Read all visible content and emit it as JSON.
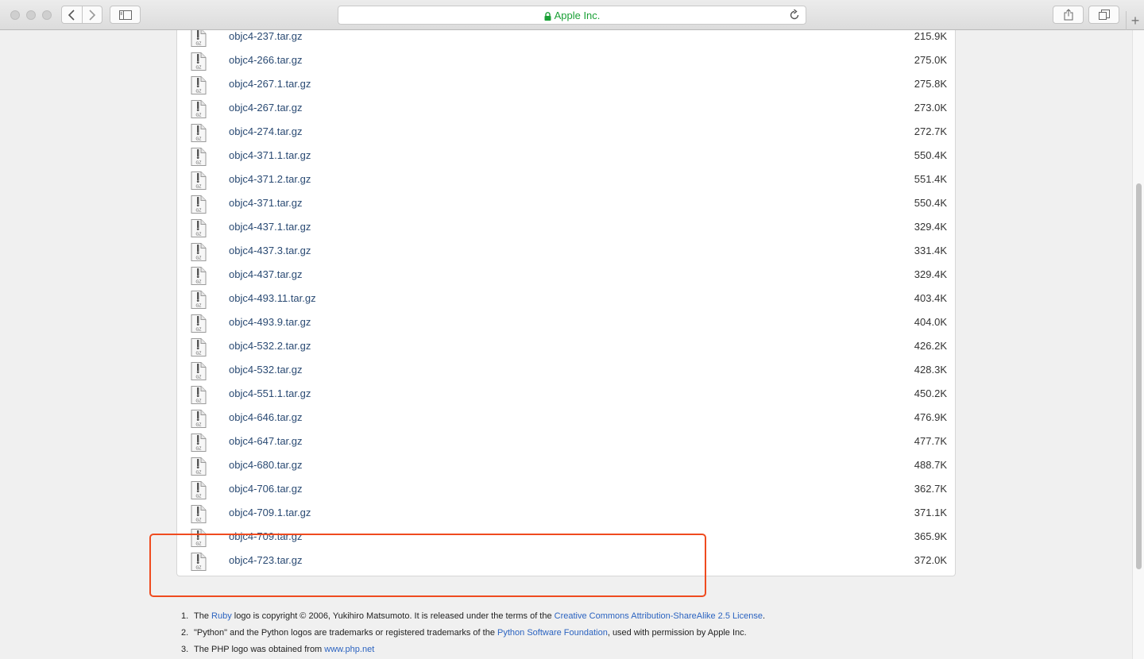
{
  "window": {
    "site_name": "Apple Inc.",
    "accent_color": "#1aa036"
  },
  "toolbar": {
    "icons": [
      "back-icon",
      "forward-icon",
      "sidebar-icon",
      "lock-icon",
      "reload-icon",
      "share-icon",
      "tabs-icon",
      "new-tab-icon"
    ],
    "new_tab_label": "+"
  },
  "files": [
    {
      "name": "objc4-237.tar.gz",
      "size": "215.9K"
    },
    {
      "name": "objc4-266.tar.gz",
      "size": "275.0K"
    },
    {
      "name": "objc4-267.1.tar.gz",
      "size": "275.8K"
    },
    {
      "name": "objc4-267.tar.gz",
      "size": "273.0K"
    },
    {
      "name": "objc4-274.tar.gz",
      "size": "272.7K"
    },
    {
      "name": "objc4-371.1.tar.gz",
      "size": "550.4K"
    },
    {
      "name": "objc4-371.2.tar.gz",
      "size": "551.4K"
    },
    {
      "name": "objc4-371.tar.gz",
      "size": "550.4K"
    },
    {
      "name": "objc4-437.1.tar.gz",
      "size": "329.4K"
    },
    {
      "name": "objc4-437.3.tar.gz",
      "size": "331.4K"
    },
    {
      "name": "objc4-437.tar.gz",
      "size": "329.4K"
    },
    {
      "name": "objc4-493.11.tar.gz",
      "size": "403.4K"
    },
    {
      "name": "objc4-493.9.tar.gz",
      "size": "404.0K"
    },
    {
      "name": "objc4-532.2.tar.gz",
      "size": "426.2K"
    },
    {
      "name": "objc4-532.tar.gz",
      "size": "428.3K"
    },
    {
      "name": "objc4-551.1.tar.gz",
      "size": "450.2K"
    },
    {
      "name": "objc4-646.tar.gz",
      "size": "476.9K"
    },
    {
      "name": "objc4-647.tar.gz",
      "size": "477.7K"
    },
    {
      "name": "objc4-680.tar.gz",
      "size": "488.7K"
    },
    {
      "name": "objc4-706.tar.gz",
      "size": "362.7K"
    },
    {
      "name": "objc4-709.1.tar.gz",
      "size": "371.1K"
    },
    {
      "name": "objc4-709.tar.gz",
      "size": "365.9K"
    },
    {
      "name": "objc4-723.tar.gz",
      "size": "372.0K"
    }
  ],
  "file_icon": {
    "name": "gz-archive-icon",
    "label": "GZ"
  },
  "footnotes": [
    {
      "number": "1.",
      "pre": "The ",
      "link1": "Ruby",
      "mid": " logo is copyright © 2006, Yukihiro Matsumoto. It is released under the terms of the ",
      "link2": "Creative Commons Attribution-ShareAlike 2.5 License",
      "post": "."
    },
    {
      "number": "2.",
      "pre": "\"Python\" and the Python logos are trademarks or registered trademarks of the ",
      "link1": "Python Software Foundation",
      "post": ", used with permission by Apple Inc."
    },
    {
      "number": "3.",
      "pre": "The PHP logo was obtained from ",
      "link1": "www.php.net"
    }
  ],
  "annotation": {
    "color": "#ef4b1f"
  }
}
